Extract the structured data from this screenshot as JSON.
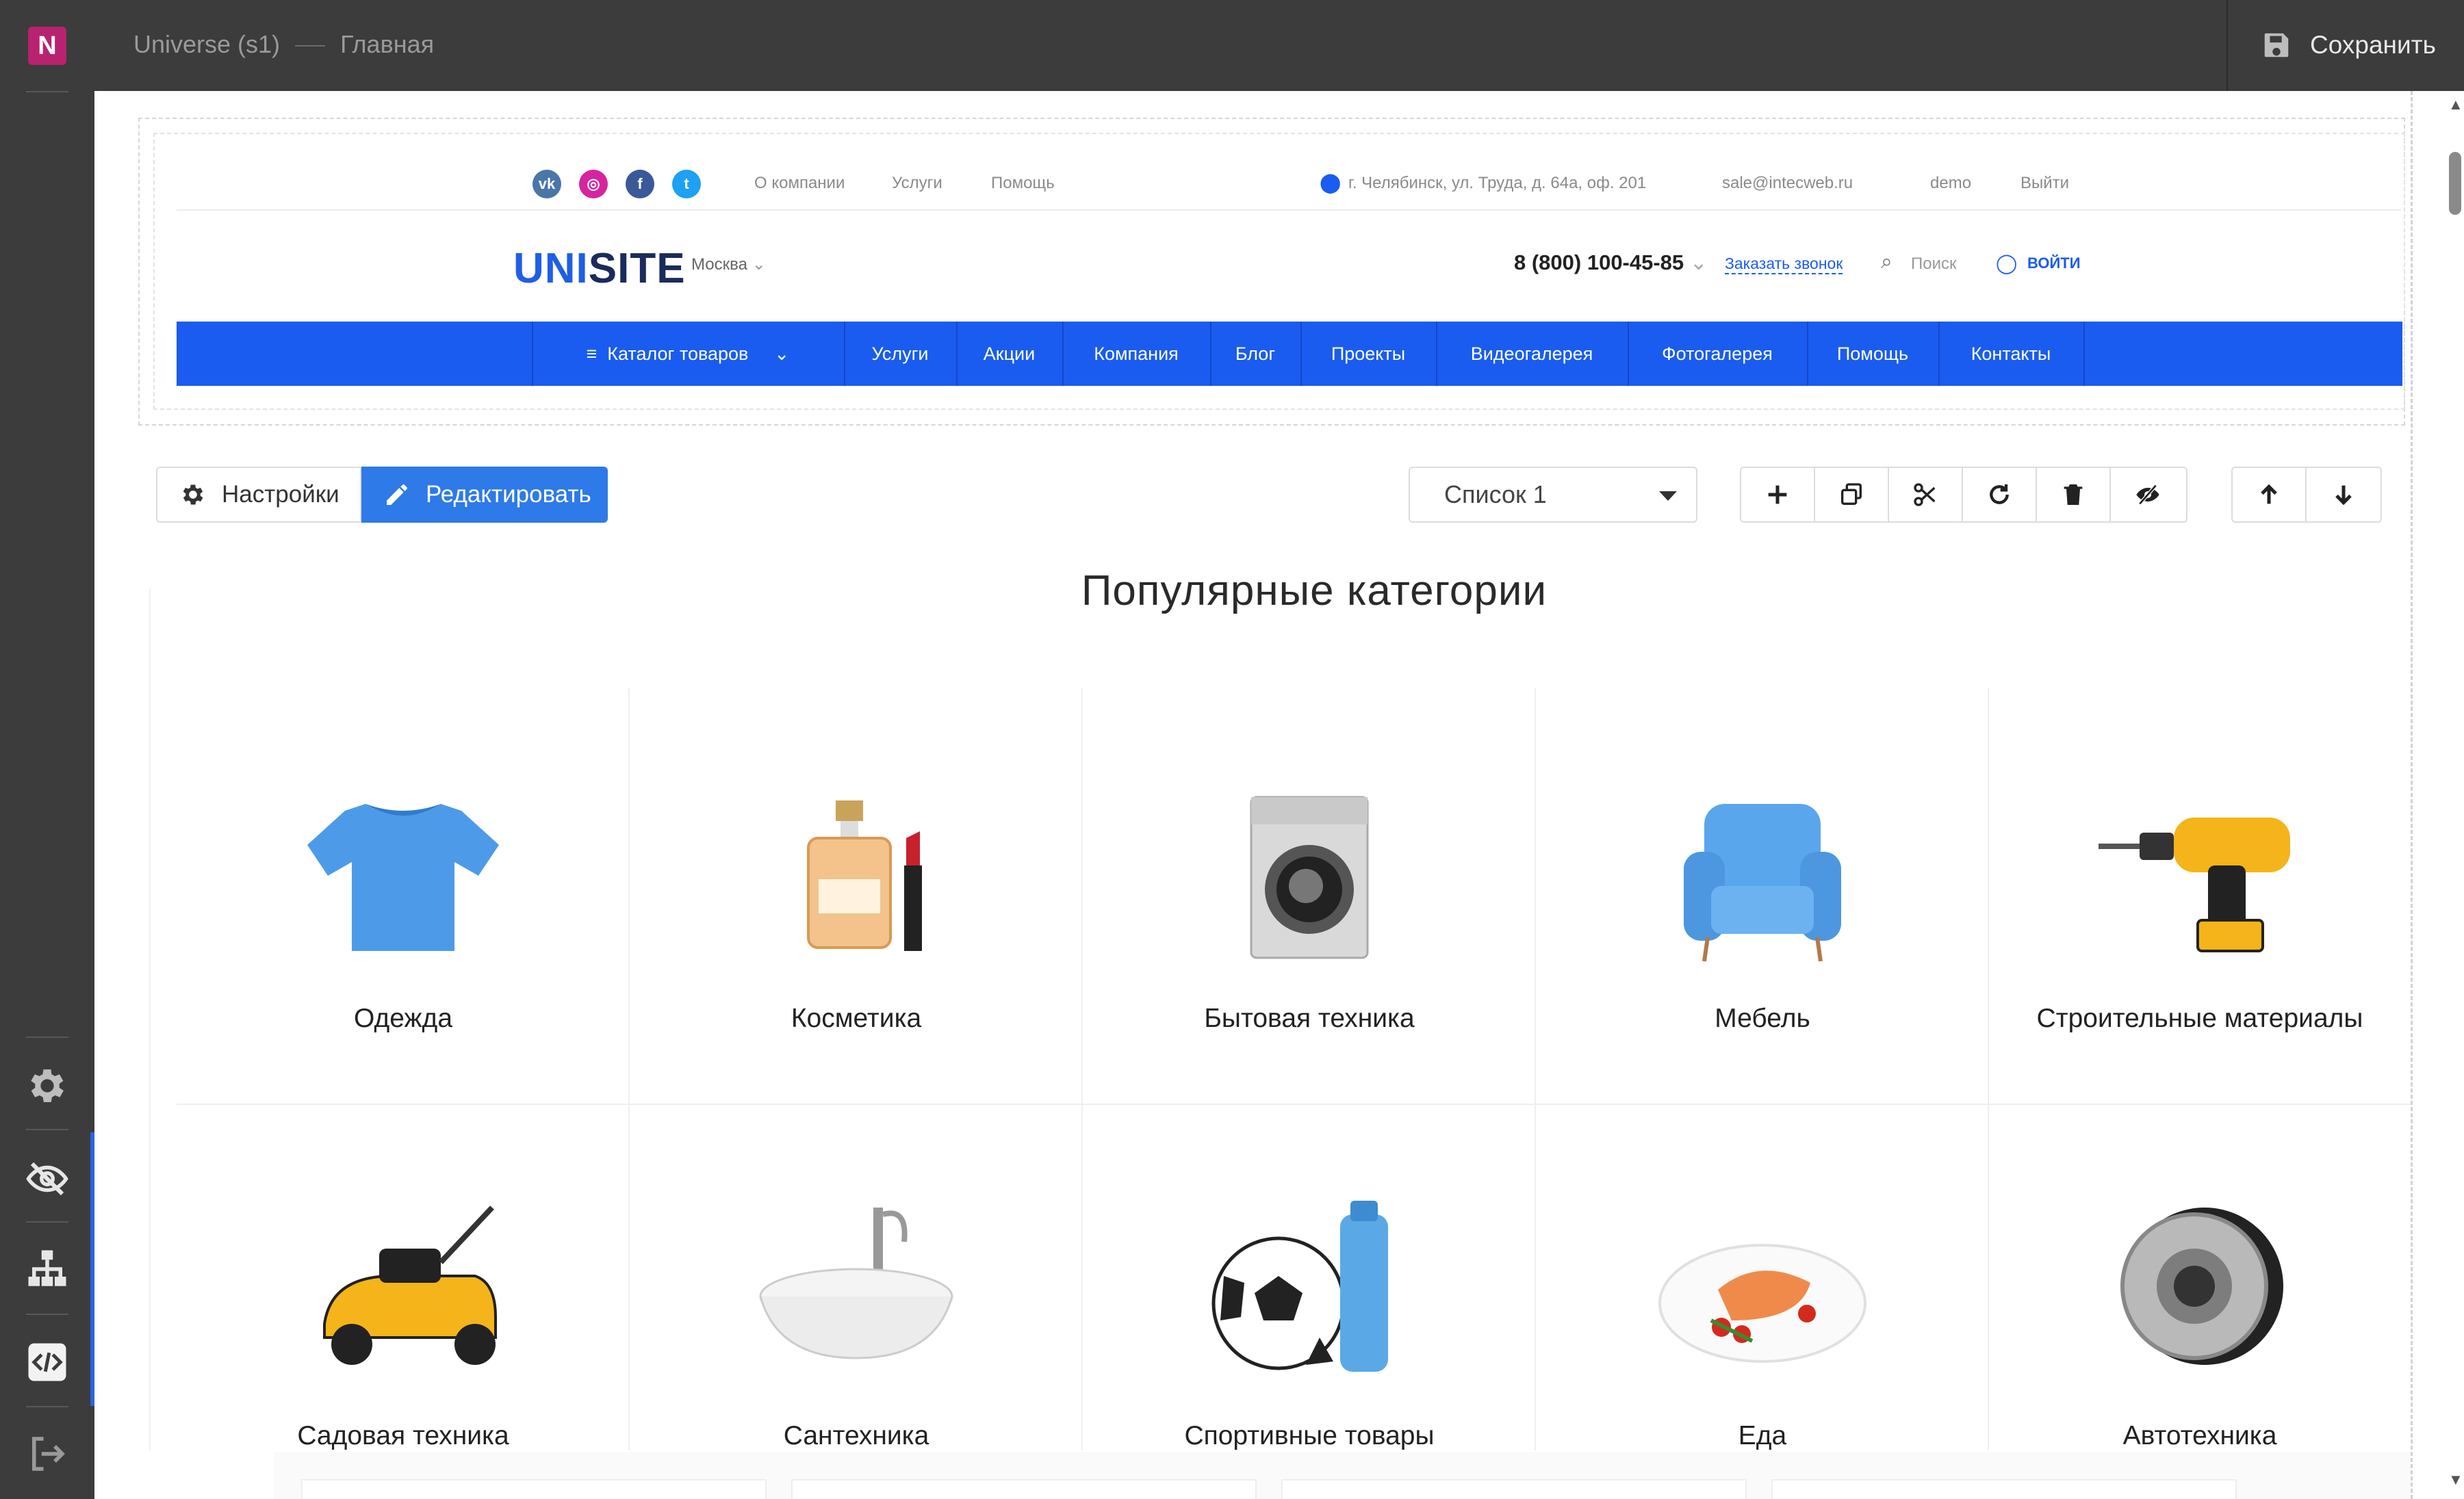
{
  "editor": {
    "logo_letter": "N",
    "breadcrumb": {
      "site": "Universe (s1)",
      "page": "Главная"
    },
    "save_label": "Сохранить",
    "sidebar_icons": [
      "gear-icon",
      "eye-off-icon",
      "sitemap-icon",
      "code-icon",
      "exit-icon"
    ]
  },
  "site": {
    "topbar": {
      "socials": [
        "vk",
        "instagram",
        "facebook",
        "twitter"
      ],
      "links": [
        "О компании",
        "Услуги",
        "Помощь"
      ],
      "address": "г. Челябинск, ул. Труда, д. 64а, оф. 201",
      "email": "sale@intecweb.ru",
      "user": "demo",
      "logout": "Выйти"
    },
    "header": {
      "logo_u": "UNI",
      "logo_rest": "SITE",
      "city": "Москва",
      "phone": "8 (800) 100-45-85",
      "callback": "Заказать звонок",
      "search": "Поиск",
      "login": "ВОЙТИ"
    },
    "nav": [
      "Каталог товаров",
      "Услуги",
      "Акции",
      "Компания",
      "Блог",
      "Проекты",
      "Видеогалерея",
      "Фотогалерея",
      "Помощь",
      "Контакты"
    ]
  },
  "block_toolbar": {
    "settings_label": "Настройки",
    "edit_label": "Редактировать",
    "select_value": "Список 1"
  },
  "categories": {
    "title": "Популярные категории",
    "items": [
      "Одежда",
      "Косметика",
      "Бытовая техника",
      "Мебель",
      "Строительные материалы",
      "Садовая техника",
      "Сантехника",
      "Спортивные товары",
      "Еда",
      "Автотехника"
    ]
  },
  "colors": {
    "chrome": "#3c3c3c",
    "brand_pink": "#b7236f",
    "nav_blue": "#1a5cf0",
    "edit_blue": "#2e7ae8"
  }
}
